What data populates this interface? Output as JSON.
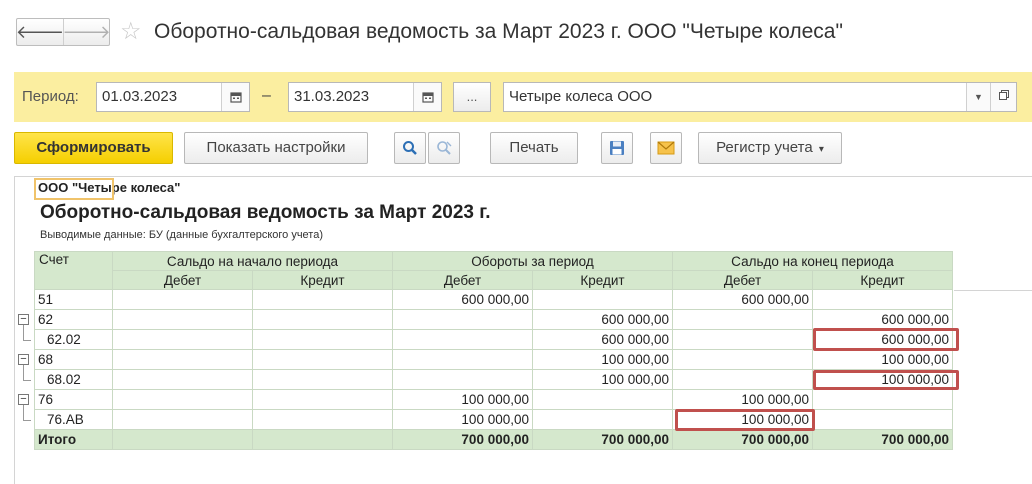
{
  "window": {
    "back_glyph": "🡐",
    "forward_glyph": "🡒",
    "star_glyph": "☆",
    "title": "Оборотно-сальдовая ведомость за Март 2023 г. ООО \"Четыре колеса\""
  },
  "period": {
    "label": "Период:",
    "from": "01.03.2023",
    "dash": "–",
    "to": "31.03.2023",
    "dots_label": "...",
    "organization": "Четыре колеса ООО"
  },
  "toolbar": {
    "generate": "Сформировать",
    "show_settings": "Показать настройки",
    "print": "Печать",
    "register": "Регистр учета",
    "register_arrow": "▾"
  },
  "report": {
    "org_name_part1": "ООО \"Че",
    "org_name_part2": "тыре колеса\"",
    "title": "Оборотно-сальдовая ведомость за Март 2023 г.",
    "subtitle": "Выводимые данные: БУ (данные бухгалтерского учета)",
    "headers": {
      "account": "Счет",
      "opening": "Сальдо на начало периода",
      "turnover": "Обороты за период",
      "closing": "Сальдо на конец периода",
      "debit": "Дебет",
      "credit": "Кредит"
    },
    "rows": [
      {
        "account": "51",
        "od": "",
        "oc": "",
        "td": "600 000,00",
        "tc": "",
        "cd": "600 000,00",
        "cc": ""
      },
      {
        "account": "62",
        "od": "",
        "oc": "",
        "td": "",
        "tc": "600 000,00",
        "cd": "",
        "cc": "600 000,00"
      },
      {
        "account": "62.02",
        "od": "",
        "oc": "",
        "td": "",
        "tc": "600 000,00",
        "cd": "",
        "cc": "600 000,00"
      },
      {
        "account": "68",
        "od": "",
        "oc": "",
        "td": "",
        "tc": "100 000,00",
        "cd": "",
        "cc": "100 000,00"
      },
      {
        "account": "68.02",
        "od": "",
        "oc": "",
        "td": "",
        "tc": "100 000,00",
        "cd": "",
        "cc": "100 000,00"
      },
      {
        "account": "76",
        "od": "",
        "oc": "",
        "td": "100 000,00",
        "tc": "",
        "cd": "100 000,00",
        "cc": ""
      },
      {
        "account": "76.АВ",
        "od": "",
        "oc": "",
        "td": "100 000,00",
        "tc": "",
        "cd": "100 000,00",
        "cc": ""
      }
    ],
    "total": {
      "account": "Итого",
      "od": "",
      "oc": "",
      "td": "700 000,00",
      "tc": "700 000,00",
      "cd": "700 000,00",
      "cc": "700 000,00"
    },
    "collapse_glyph": "−"
  },
  "colors": {
    "period_bar": "#fbeea0",
    "primary_button": "#f5cf00",
    "table_header": "#d5e8cd",
    "highlight": "#c0504d"
  }
}
